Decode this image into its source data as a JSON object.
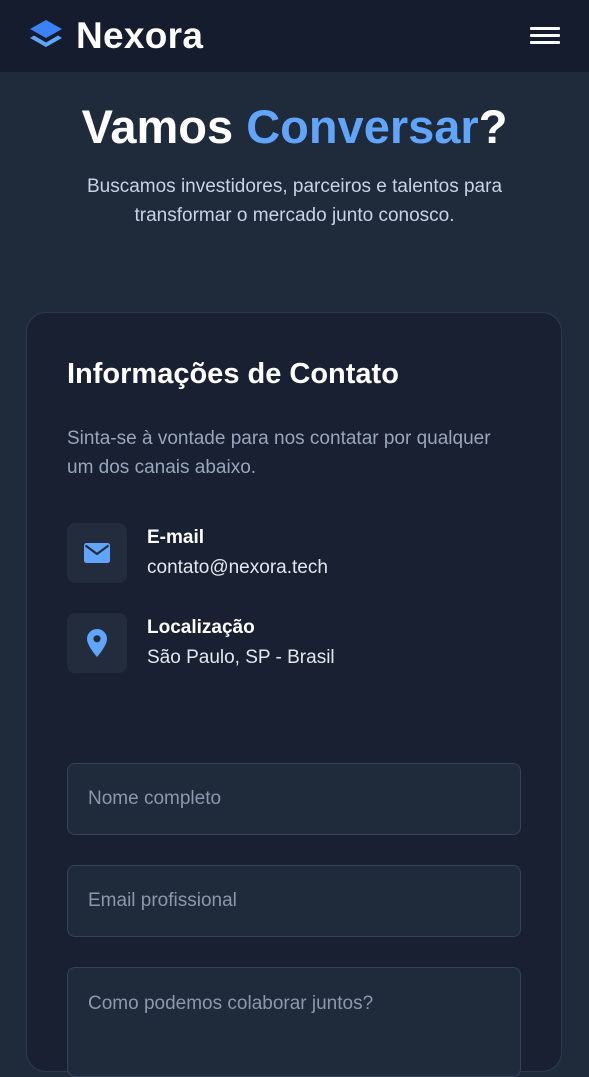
{
  "header": {
    "brand_name": "Nexora",
    "logo_icon": "layers-logo-icon",
    "menu_icon": "hamburger-menu-icon"
  },
  "hero": {
    "title_part1": "Vamos ",
    "title_accent": "Conversar",
    "title_part2": "?",
    "subtitle": "Buscamos investidores, parceiros e talentos para transformar o mercado junto conosco."
  },
  "contact_card": {
    "title": "Informações de Contato",
    "description": "Sinta-se à vontade para nos contatar por qualquer um dos canais abaixo.",
    "items": [
      {
        "icon": "envelope-icon",
        "label": "E-mail",
        "value": "contato@nexora.tech"
      },
      {
        "icon": "map-pin-icon",
        "label": "Localização",
        "value": "São Paulo, SP - Brasil"
      }
    ]
  },
  "form": {
    "name_placeholder": "Nome completo",
    "name_value": "",
    "email_placeholder": "Email profissional",
    "email_value": "",
    "message_placeholder": "Como podemos colaborar juntos?",
    "message_value": ""
  },
  "colors": {
    "page_bg": "#1f2a3b",
    "header_bg": "#141c2d",
    "card_bg": "#182032",
    "accent": "#60a5fa",
    "text_primary": "#ffffff",
    "text_muted": "#99a6bb"
  }
}
